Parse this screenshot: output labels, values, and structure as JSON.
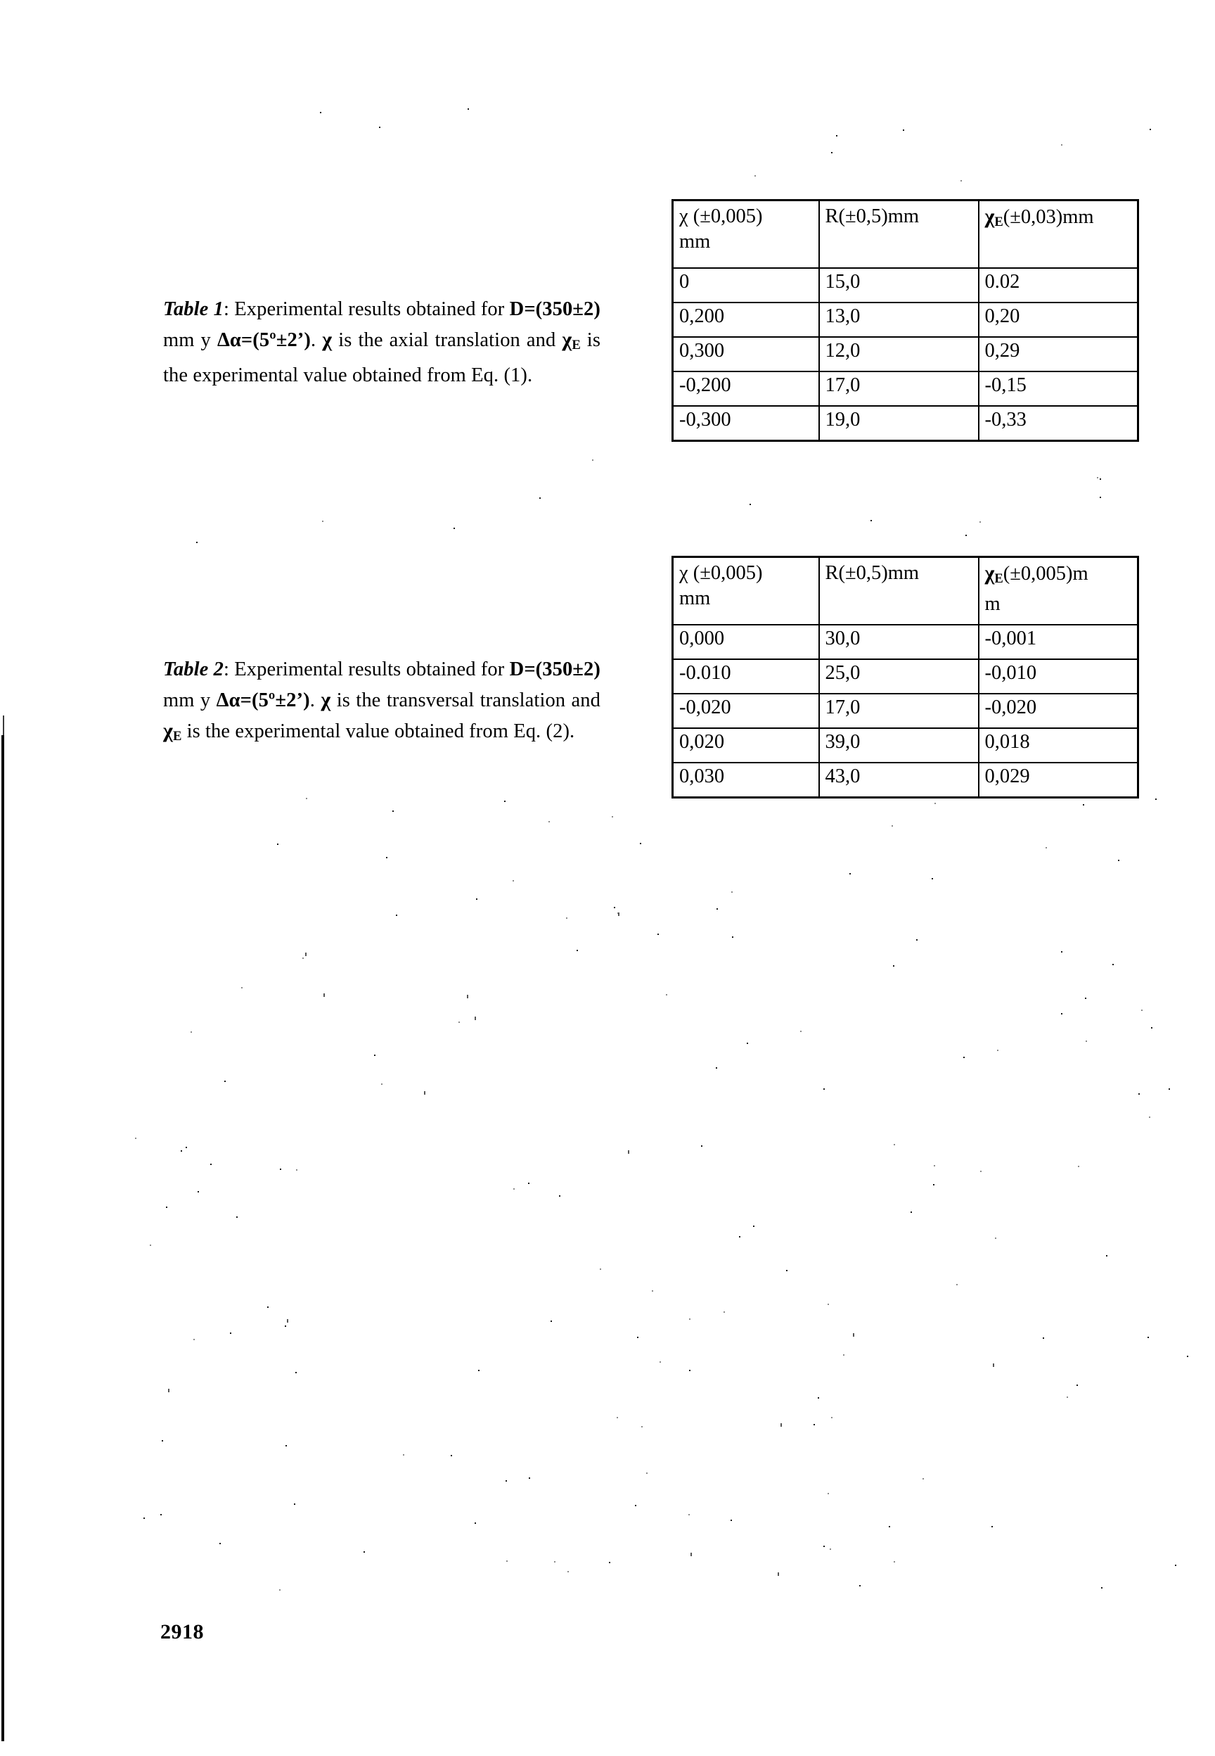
{
  "page": {
    "folio": "2918"
  },
  "captions": {
    "table1": {
      "label": "Table 1",
      "label_suffix": ":",
      "text_a": " Experimental results obtained for ",
      "distance": "D=(350±2)",
      "text_b": " mm y ",
      "angle": "Δα=(5º±2’)",
      "text_c": ". ",
      "chi": "χ",
      "text_d": " is the axial translation and ",
      "chi_e": "χ",
      "chi_e_sub": "E",
      "text_e": " is the experimental value obtained from Eq. (1)."
    },
    "table2": {
      "label": "Table 2",
      "label_suffix": ":",
      "text_a": " Experimental results obtained for ",
      "distance": "D=(350±2)",
      "text_b": " mm y ",
      "angle": "Δα=(5º±2’)",
      "text_c": ". ",
      "chi": "χ",
      "text_d": " is the transversal translation and ",
      "chi_e": "χ",
      "chi_e_sub": "E",
      "text_e": " is the experimental value obtained from Eq. (2)."
    }
  },
  "table1": {
    "headers": [
      {
        "main": "χ (±0,005)",
        "line2": "mm"
      },
      {
        "main": "R(±0,5)mm",
        "line2": ""
      },
      {
        "main_pre": "χ",
        "main_sub": "E",
        "main_post": "(±0,03)mm",
        "line2": ""
      }
    ],
    "rows": [
      [
        "0",
        "15,0",
        "0.02"
      ],
      [
        " 0,200",
        "13,0",
        "0,20"
      ],
      [
        " 0,300",
        "12,0",
        "0,29"
      ],
      [
        "-0,200",
        "17,0",
        "-0,15"
      ],
      [
        "-0,300",
        "19,0",
        "-0,33"
      ]
    ]
  },
  "table2": {
    "headers": [
      {
        "main": "χ (±0,005)",
        "line2": "mm"
      },
      {
        "main": "R(±0,5)mm",
        "line2": ""
      },
      {
        "main_pre": "χ",
        "main_sub": "E",
        "main_post": "(±0,005)m",
        "line2": "m"
      }
    ],
    "rows": [
      [
        " 0,000",
        "30,0",
        "-0,001"
      ],
      [
        "-0.010",
        "25,0",
        "-0,010"
      ],
      [
        "-0,020",
        "17,0",
        "-0,020"
      ],
      [
        " 0,020",
        "39,0",
        " 0,018"
      ],
      [
        "0,030",
        "43,0",
        " 0,029"
      ]
    ]
  }
}
